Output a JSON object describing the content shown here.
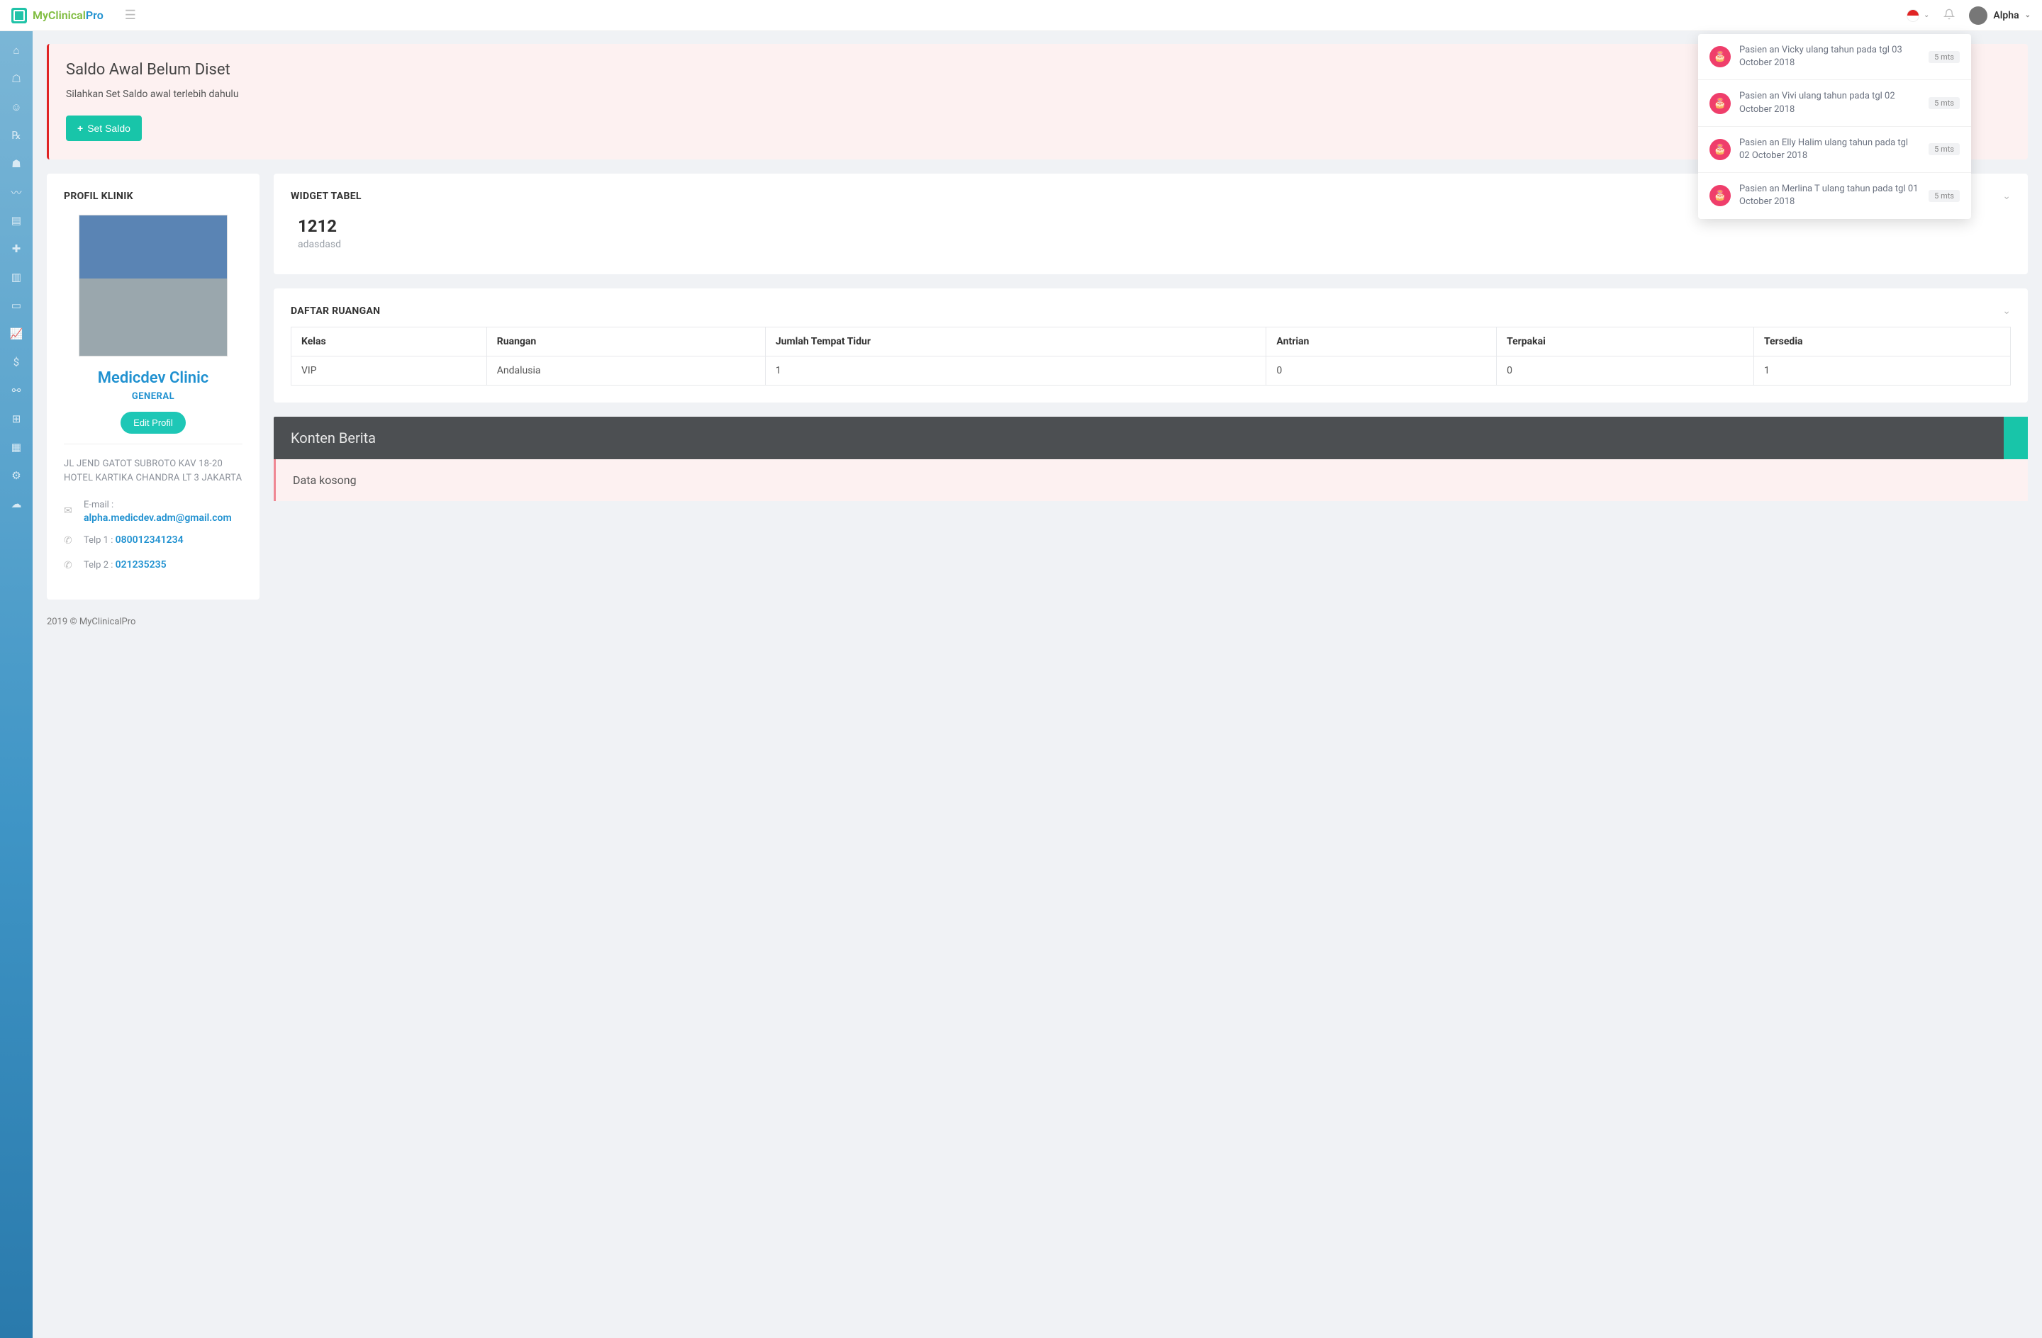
{
  "brand": {
    "name1": "MyClinical",
    "name2": "Pro"
  },
  "header": {
    "username": "Alpha"
  },
  "notifications": [
    {
      "text": "Pasien an Vicky ulang tahun pada tgl 03 October 2018",
      "time": "5 mts"
    },
    {
      "text": "Pasien an Vivi ulang tahun pada tgl 02 October 2018",
      "time": "5 mts"
    },
    {
      "text": "Pasien an Elly Halim ulang tahun pada tgl 02 October 2018",
      "time": "5 mts"
    },
    {
      "text": "Pasien an Merlina T ulang tahun pada tgl 01 October 2018",
      "time": "5 mts"
    }
  ],
  "alert": {
    "title": "Saldo Awal Belum Diset",
    "body": "Silahkan Set Saldo awal terlebih dahulu",
    "button": "Set Saldo"
  },
  "profile": {
    "heading": "PROFIL KLINIK",
    "name": "Medicdev Clinic",
    "type": "GENERAL",
    "edit": "Edit Profil",
    "address": "JL JEND GATOT SUBROTO KAV 18-20 HOTEL KARTIKA CHANDRA LT 3 JAKARTA",
    "email_label": "E-mail :",
    "email": "alpha.medicdev.adm@gmail.com",
    "tel1_label": "Telp 1 : ",
    "tel1": "080012341234",
    "tel2_label": "Telp 2 : ",
    "tel2": "021235235"
  },
  "widget": {
    "heading": "WIDGET TABEL",
    "value": "1212",
    "sub": "adasdasd"
  },
  "rooms": {
    "heading": "DAFTAR RUANGAN",
    "cols": [
      "Kelas",
      "Ruangan",
      "Jumlah Tempat Tidur",
      "Antrian",
      "Terpakai",
      "Tersedia"
    ],
    "rows": [
      [
        "VIP",
        "Andalusia",
        "1",
        "0",
        "0",
        "1"
      ]
    ]
  },
  "news": {
    "heading": "Konten Berita",
    "empty": "Data kosong"
  },
  "footer": "2019 © MyClinicalPro"
}
